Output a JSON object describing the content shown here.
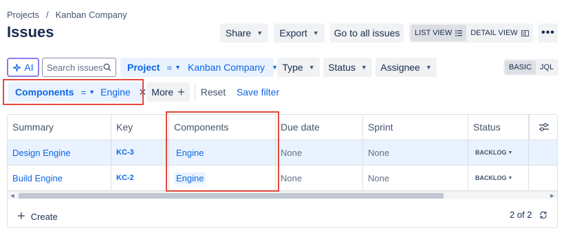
{
  "breadcrumbs": {
    "root": "Projects",
    "separator": "/",
    "project": "Kanban Company"
  },
  "page_title": "Issues",
  "header_actions": {
    "share": "Share",
    "export": "Export",
    "go_all": "Go to all issues",
    "list_view": "LIST VIEW",
    "detail_view": "DETAIL VIEW",
    "more": "•••"
  },
  "filters": {
    "ai_label": "AI",
    "search_placeholder": "Search issues",
    "project_label": "Project",
    "project_op": "=",
    "project_value": "Kanban Company",
    "type": "Type",
    "status": "Status",
    "assignee": "Assignee",
    "basic": "BASIC",
    "jql": "JQL",
    "components_label": "Components",
    "components_op": "=",
    "components_value": "Engine",
    "more": "More",
    "reset": "Reset",
    "save_filter": "Save filter"
  },
  "table": {
    "columns": [
      "Summary",
      "Key",
      "Components",
      "Due date",
      "Sprint",
      "Status"
    ],
    "rows": [
      {
        "summary": "Design Engine",
        "key": "KC-3",
        "component": "Engine",
        "due": "None",
        "sprint": "None",
        "status": "BACKLOG"
      },
      {
        "summary": "Build Engine",
        "key": "KC-2",
        "component": "Engine",
        "due": "None",
        "sprint": "None",
        "status": "BACKLOG"
      }
    ]
  },
  "footer": {
    "create": "Create",
    "count": "2 of 2"
  },
  "colors": {
    "accent": "#0c66e4",
    "highlight": "#e2483d",
    "selected_row": "#e9f2ff"
  }
}
